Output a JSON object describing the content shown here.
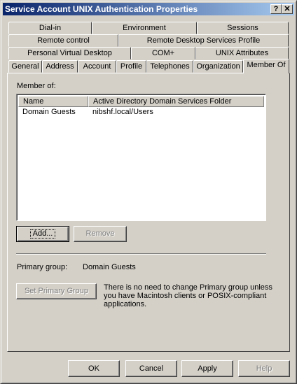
{
  "window": {
    "title": "Service Account UNIX Authentication Properties",
    "help_glyph": "?",
    "close_glyph": "✕"
  },
  "tabs": {
    "row1": [
      "Dial-in",
      "Environment",
      "Sessions"
    ],
    "row2": [
      "Remote control",
      "Remote Desktop Services Profile"
    ],
    "row3": [
      "Personal Virtual Desktop",
      "COM+",
      "UNIX Attributes"
    ],
    "row4": [
      "General",
      "Address",
      "Account",
      "Profile",
      "Telephones",
      "Organization",
      "Member Of"
    ],
    "active": "Member Of"
  },
  "member_of": {
    "label": "Member of:",
    "columns": [
      "Name",
      "Active Directory Domain Services Folder"
    ],
    "rows": [
      {
        "name": "Domain Guests",
        "folder": "nibshf.local/Users"
      }
    ]
  },
  "buttons": {
    "add": "Add...",
    "remove": "Remove",
    "set_primary": "Set Primary Group",
    "ok": "OK",
    "cancel": "Cancel",
    "apply": "Apply",
    "help": "Help"
  },
  "primary_group": {
    "label": "Primary group:",
    "value": "Domain Guests",
    "note": [
      "There is no need to change Primary group unless",
      "you have Macintosh clients or POSIX-compliant",
      "applications."
    ]
  }
}
